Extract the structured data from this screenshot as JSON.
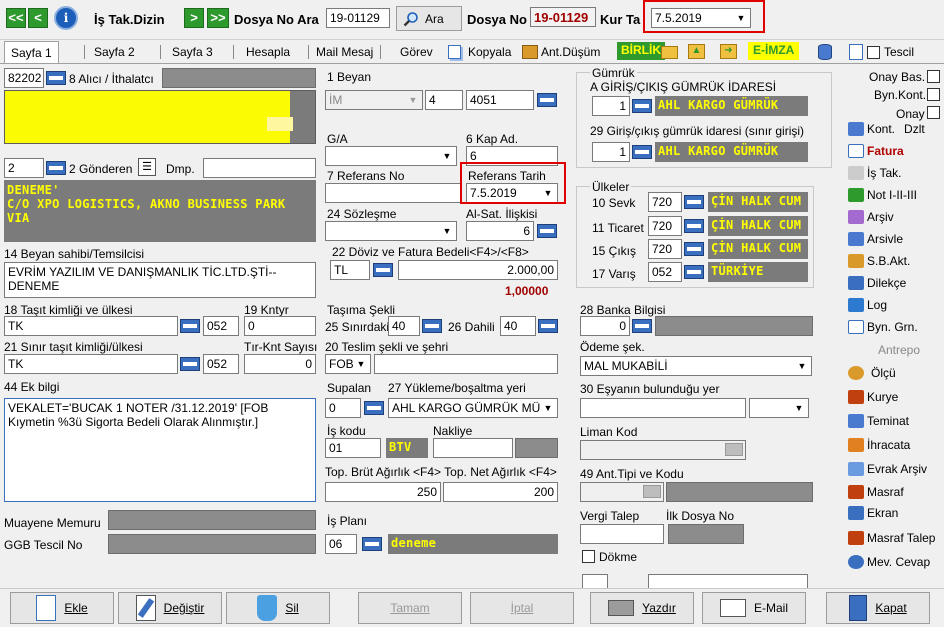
{
  "toolbar": {
    "is_tak_dizin": "İş Tak.Dizin",
    "dosya_no_ara_label": "Dosya No Ara",
    "dosya_no_ara_value": "19-01129",
    "ara_button": "Ara",
    "dosya_no_label": "Dosya No",
    "dosya_no_value": "19-01129",
    "kur_ta_label": "Kur Ta",
    "kur_ta_value": "7.5.2019"
  },
  "tabs": [
    "Sayfa 1",
    "Sayfa 2",
    "Sayfa 3",
    "Hesapla",
    "Mail Mesaj",
    "Görev",
    "Kopyala",
    "Ant.Düşüm",
    "BİRLİK",
    "E-İMZA",
    "Tescil"
  ],
  "left": {
    "alici_code": "82202",
    "alici_label": "8 Alıcı / İthalatcı",
    "gonderen_code": "2",
    "gonderen_label": "2 Gönderen",
    "dmp_label": "Dmp.",
    "gonderen_text": "DENEME'\nC/O XPO LOGISTICS, AKNO BUSINESS PARK\nVIA",
    "beyan_sahibi_label": "14 Beyan sahibi/Temsilcisi",
    "beyan_sahibi_value": "EVRİM YAZILIM VE DANIŞMANLIK TİC.LTD.ŞTİ--\nDENEME",
    "tasit_label": "18 Taşıt kimliği ve ülkesi",
    "tasit_value": "TK",
    "tasit_ulke": "052",
    "kntyr_label": "19 Kntyr",
    "kntyr_value": "0",
    "sinir_tasit_label": "21 Sınır taşıt kimliği/ülkesi",
    "sinir_tasit_value": "TK",
    "sinir_ulke": "052",
    "tir_label": "Tır-Knt Sayısı",
    "tir_value": "0",
    "ek_bilgi_label": "44 Ek bilgi",
    "ek_bilgi_value": "VEKALET='BUCAK 1 NOTER /31.12.2019' [FOB Kıymetin %3ü Sigorta Bedeli Olarak Alınmıştır.]",
    "muayene_label": "Muayene Memuru",
    "ggb_label": "GGB Tescil No"
  },
  "mid": {
    "beyan_label": "1 Beyan",
    "beyan_im": "İM",
    "beyan_4": "4",
    "beyan_code": "4051",
    "ga_label": "G/A",
    "kap_label": "6 Kap Ad.",
    "kap_value": "6",
    "ref_no_label": "7 Referans No",
    "ref_tarih_label": "Referans Tarih",
    "ref_tarih_value": "7.5.2019",
    "sozlesme_label": "24 Sözleşme",
    "alsat_label": "Al-Sat. İlişkisi",
    "alsat_value": "6",
    "doviz_label": "22 Döviz ve Fatura Bedeli<F4>/<F8>",
    "doviz_cur": "TL",
    "doviz_amount": "2.000,00",
    "doviz_rate": "1,00000",
    "tasima_label": "Taşıma Şekli",
    "sinir_label": "25 Sınırdaki",
    "sinir_value": "40",
    "dahili_label": "26 Dahili",
    "dahili_value": "40",
    "teslim_label": "20 Teslim şekli ve şehri",
    "teslim_value": "FOB",
    "supalan_label": "Supalan",
    "supalan_value": "0",
    "yukleme_label": "27 Yükleme/boşaltma yeri",
    "yukleme_value": "AHL KARGO GÜMRÜK MÜ",
    "is_kodu_label": "İş kodu",
    "is_kodu_value": "01",
    "btv": "BTV",
    "nakliye_label": "Nakliye",
    "agirlik_label": "Top. Brüt Ağırlık <F4> Top. Net Ağırlık <F4>",
    "brut_value": "250",
    "net_value": "200",
    "is_plani_label": "İş Planı",
    "is_plani_code": "06",
    "is_plani_name": "deneme"
  },
  "right": {
    "gumruk_label": "Gümrük",
    "giris_label": "A GİRİŞ/ÇIKIŞ GÜMRÜK İDARESİ",
    "giris_code": "1",
    "giris_name": "AHL KARGO GÜMRÜK",
    "gidare_label": "29 Giriş/çıkış gümrük idaresi (sınır girişi)",
    "gidare_code": "1",
    "gidare_name": "AHL KARGO GÜMRÜK",
    "ulkeler_label": "Ülkeler",
    "sevk_label": "10 Sevk",
    "sevk_code": "720",
    "sevk_name": "ÇİN HALK CUM",
    "ticaret_label": "11 Ticaret",
    "ticaret_code": "720",
    "ticaret_name": "ÇİN HALK CUM",
    "cikis_label": "15 Çıkış",
    "cikis_code": "720",
    "cikis_name": "ÇİN HALK CUM",
    "varis_label": "17 Varış",
    "varis_code": "052",
    "varis_name": "TÜRKİYE",
    "banka_label": "28 Banka Bilgisi",
    "banka_code": "0",
    "odeme_label": "Ödeme şek.",
    "odeme_value": "MAL MUKABİLİ",
    "esya_label": "30 Eşyanın bulunduğu yer",
    "liman_label": "Liman Kod",
    "ant_label": "49 Ant.Tipi ve Kodu",
    "vergi_label": "Vergi Talep",
    "ilk_dosya_label": "İlk Dosya No",
    "dokme_label": "Dökme"
  },
  "sidebar": {
    "onay_bas": "Onay Bas.",
    "byn_kont": "Byn.Kont.",
    "onay": "Onay",
    "kont": "Kont.",
    "dzlt": "Dzlt",
    "items": [
      "Fatura",
      "İş Tak.",
      "Not I-II-III",
      "Arşiv",
      "Arsivle",
      "S.B.Akt.",
      "Dilekçe",
      "Log",
      "Byn. Grn.",
      "Antrepo",
      "Ölçü",
      "Kurye",
      "Teminat",
      "İhracata",
      "Evrak Arşiv",
      "Masraf",
      "Ekran",
      "Masraf Talep",
      "Mev. Cevap"
    ]
  },
  "buttons": {
    "ekle": "Ekle",
    "degistir": "Değiştir",
    "sil": "Sil",
    "tamam": "Tamam",
    "iptal": "İptal",
    "yazdir": "Yazdır",
    "email": "E-Mail",
    "kapat": "Kapat"
  },
  "colors": {
    "highlight_yellow": "#ffff00",
    "annotation_red": "#e00000",
    "field_gray": "#7b7b7b",
    "nav_green": "#2e9a2e"
  }
}
